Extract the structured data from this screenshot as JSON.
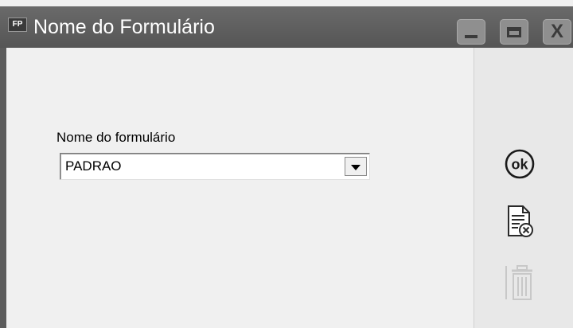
{
  "window": {
    "app_icon_text": "FP",
    "title": "Nome do Formulário",
    "controls": [
      "minimize-icon",
      "maximize-icon",
      "close-icon"
    ]
  },
  "form": {
    "field_label": "Nome do formulário",
    "select_value": "PADRAO"
  },
  "sidebar": {
    "ok_label": "ok",
    "items": [
      {
        "icon": "ok-icon",
        "enabled": true
      },
      {
        "icon": "document-cancel-icon",
        "enabled": true
      },
      {
        "icon": "trash-icon",
        "enabled": false
      }
    ]
  },
  "colors": {
    "titlebar": "#5e5e5e",
    "content_bg": "#f0f0f0",
    "side_panel_bg": "#e8e8e8",
    "disabled_icon": "#c8c8c8"
  }
}
